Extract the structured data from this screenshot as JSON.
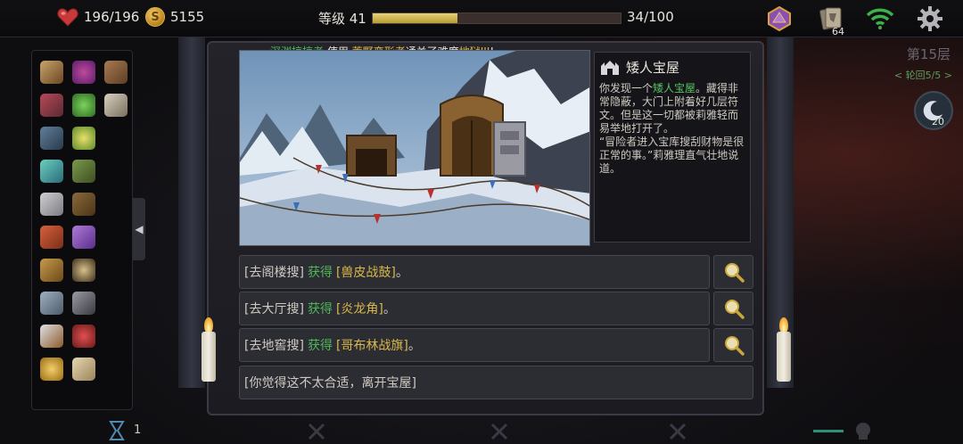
{
  "colors": {
    "hp": "#c83a3a",
    "gold": "#e2b548",
    "xp": "#d8c35e",
    "green": "#4fb65a",
    "highlight": "#d9b84a"
  },
  "status": {
    "hp": "196/196",
    "gold": "5155",
    "level_label": "等级 41",
    "xp_text": "34/100",
    "xp_progress": 0.34
  },
  "top_icons": {
    "cards_count": "64"
  },
  "floor": {
    "label": "第15层",
    "cycle": "< 轮回5/5 >",
    "moon_count": "20"
  },
  "inventory": {
    "items": [
      "winged-helm-icon",
      "berries-icon",
      "leather-bag-icon",
      "spellbook-plus-icon",
      "green-bowl-icon",
      "owl-icon",
      "box-plus-icon",
      "bell-plus-icon",
      "",
      "potion-plus-icon",
      "branch-plus-icon",
      "",
      "gear-box-icon",
      "tome-plus-icon",
      "",
      "scroll-plus-icon",
      "purple-candle-icon",
      "",
      "chest-plus-icon",
      "spiked-ball-icon",
      "",
      "chest-icon",
      "tongs-icon",
      "",
      "dagger-icon",
      "red-orb-icon",
      "",
      "gold-coin-icon",
      "parchment-icon",
      ""
    ]
  },
  "event_log": {
    "name": "深渊掠掠者",
    "verb": "使用",
    "hero": "荒野变形者",
    "middle": "通关了难度",
    "difficulty": "地狱III",
    "end": "!"
  },
  "event": {
    "title": "矮人宝屋",
    "body_1": "你发现一个",
    "body_hl": "矮人宝屋",
    "body_2": "。藏得非常隐蔽，大门上附着好几层符文。但是这一切都被莉雅轻而易举地打开了。",
    "body_3": "“冒险者进入宝库搜刮财物是很正常的事。”莉雅理直气壮地说道。"
  },
  "choices": [
    {
      "action": "[去阁楼搜]",
      "get": "获得",
      "item": "[兽皮战鼓]",
      "end": "。"
    },
    {
      "action": "[去大厅搜]",
      "get": "获得",
      "item": "[炎龙角]",
      "end": "。"
    },
    {
      "action": "[去地窖搜]",
      "get": "获得",
      "item": "[哥布林战旗]",
      "end": "。"
    }
  ],
  "leave_choice": "[你觉得这不太合适，离开宝屋]",
  "bottom": {
    "counter": "1"
  }
}
